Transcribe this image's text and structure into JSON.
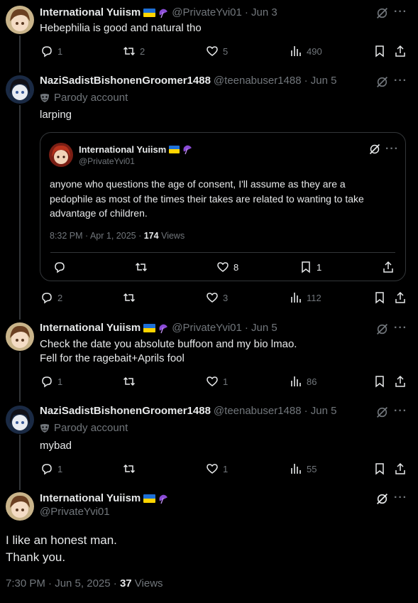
{
  "posts": [
    {
      "name": "International Yuiism",
      "handle": "@PrivateYvi01",
      "date": "· Jun 3",
      "text": [
        "Hebephilia is good and natural tho"
      ],
      "stats": {
        "replies": "1",
        "reposts": "2",
        "likes": "5",
        "views": "490"
      }
    },
    {
      "name": "NaziSadistBishonenGroomer1488",
      "handle": "@teenabuser1488",
      "date": "· Jun 5",
      "parody": "Parody account",
      "text": [
        "larping"
      ],
      "stats": {
        "replies": "2",
        "reposts": "",
        "likes": "3",
        "views": "112"
      }
    },
    {
      "name": "International Yuiism",
      "handle": "@PrivateYvi01",
      "date": "· Jun 5",
      "text": [
        "Check the date you absolute buffoon and my bio lmao.",
        "Fell for the ragebait+Aprils fool"
      ],
      "stats": {
        "replies": "1",
        "reposts": "",
        "likes": "1",
        "views": "86"
      }
    },
    {
      "name": "NaziSadistBishonenGroomer1488",
      "handle": "@teenabuser1488",
      "date": "· Jun 5",
      "parody": "Parody account",
      "text": [
        "mybad"
      ],
      "stats": {
        "replies": "1",
        "reposts": "",
        "likes": "1",
        "views": "55"
      }
    }
  ],
  "quote": {
    "name": "International Yuiism",
    "handle": "@PrivateYvi01",
    "text": [
      "anyone who questions the age of consent, I'll assume as they are a",
      "pedophile as most of the times their takes are related to wanting to take",
      "advantage of children."
    ],
    "meta": "8:32 PM · Apr 1, 2025 ·",
    "views_count": "174",
    "views_label": "Views",
    "stats": {
      "likes": "8",
      "bookmarks": "1"
    }
  },
  "focus": {
    "name": "International Yuiism",
    "handle": "@PrivateYvi01",
    "text": [
      "I like an honest man.",
      "Thank you."
    ],
    "meta": "7:30 PM · Jun 5, 2025 ·",
    "views_count": "37",
    "views_label": "Views"
  },
  "icons": [
    "reply-icon",
    "repost-icon",
    "like-icon",
    "views-icon",
    "bookmark-icon",
    "share-icon",
    "grok-icon",
    "more-icon",
    "parody-mask-icon"
  ],
  "colors": {
    "background": "#000000",
    "text": "#e7e9ea",
    "muted": "#71767b",
    "divider": "#333639"
  }
}
